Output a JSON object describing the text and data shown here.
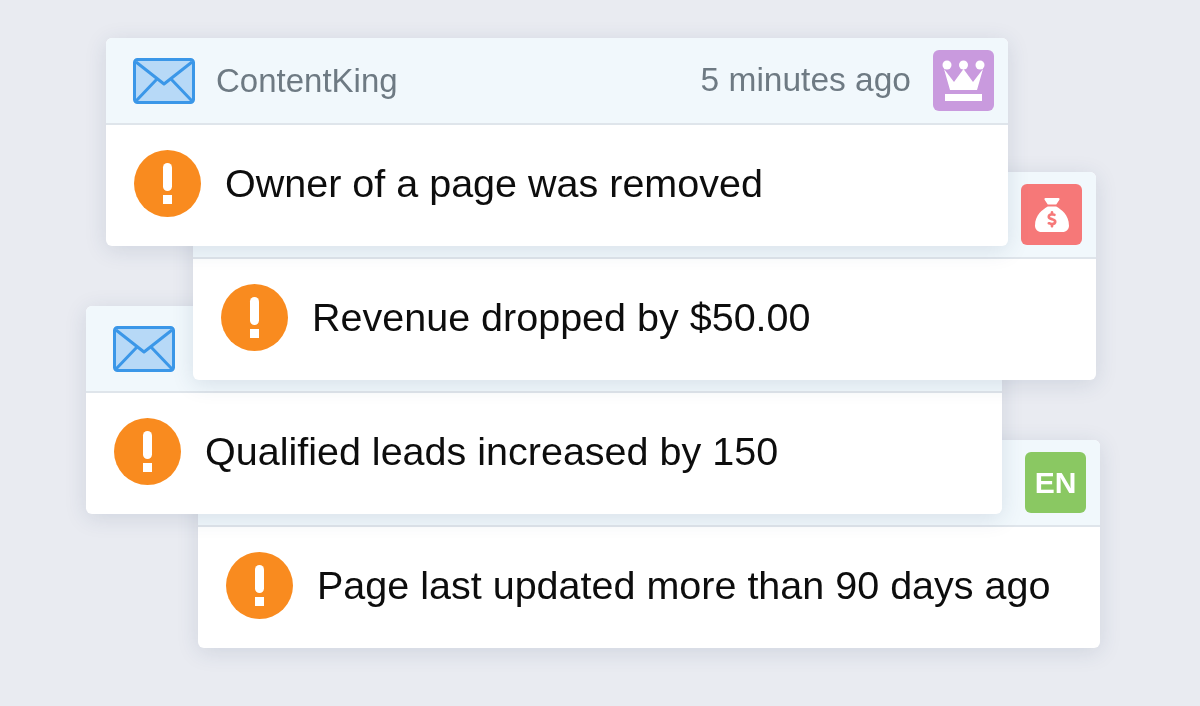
{
  "notifications": [
    {
      "mail_icon": true,
      "sender": "ContentKing",
      "time": "5 minutes ago",
      "badge": {
        "kind": "crown",
        "color": "#c99ade"
      },
      "message": "Owner of a page was removed"
    },
    {
      "mail_icon": false,
      "badge": {
        "kind": "money-bag",
        "color": "#f67878"
      },
      "message": "Revenue dropped by $50.00"
    },
    {
      "mail_icon": true,
      "message": "Qualified leads increased by 150"
    },
    {
      "mail_icon": false,
      "badge": {
        "kind": "label",
        "text": "EN",
        "color": "#8ac862"
      },
      "message": "Page last updated more than 90 days ago"
    }
  ]
}
